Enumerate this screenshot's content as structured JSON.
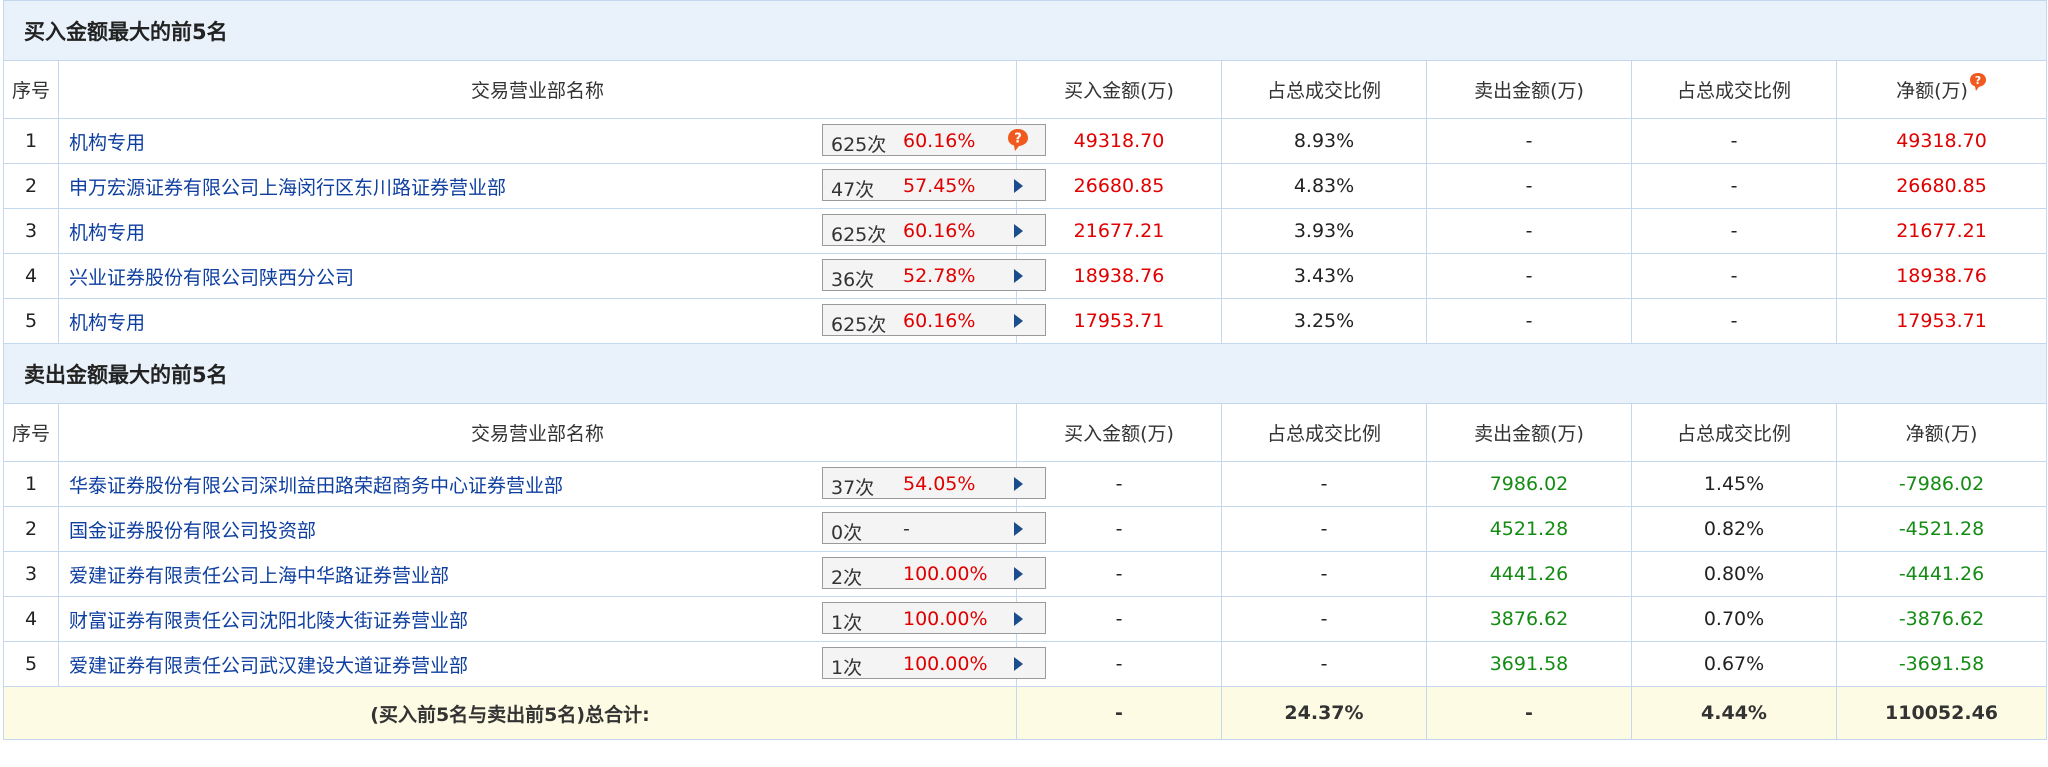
{
  "buy_section": {
    "title": "买入金额最大的前5名",
    "headers": [
      "序号",
      "交易营业部名称",
      "买入金额(万)",
      "占总成交比例",
      "卖出金额(万)",
      "占总成交比例",
      "净额(万)"
    ],
    "rows": [
      {
        "no": "1",
        "name": "机构专用",
        "count": "625次",
        "pct": "60.16%",
        "buy": "49318.70",
        "buy_ratio": "8.93%",
        "sell": "-",
        "sell_ratio": "-",
        "net": "49318.70"
      },
      {
        "no": "2",
        "name": "申万宏源证券有限公司上海闵行区东川路证券营业部",
        "count": "47次",
        "pct": "57.45%",
        "buy": "26680.85",
        "buy_ratio": "4.83%",
        "sell": "-",
        "sell_ratio": "-",
        "net": "26680.85"
      },
      {
        "no": "3",
        "name": "机构专用",
        "count": "625次",
        "pct": "60.16%",
        "buy": "21677.21",
        "buy_ratio": "3.93%",
        "sell": "-",
        "sell_ratio": "-",
        "net": "21677.21"
      },
      {
        "no": "4",
        "name": "兴业证券股份有限公司陕西分公司",
        "count": "36次",
        "pct": "52.78%",
        "buy": "18938.76",
        "buy_ratio": "3.43%",
        "sell": "-",
        "sell_ratio": "-",
        "net": "18938.76"
      },
      {
        "no": "5",
        "name": "机构专用",
        "count": "625次",
        "pct": "60.16%",
        "buy": "17953.71",
        "buy_ratio": "3.25%",
        "sell": "-",
        "sell_ratio": "-",
        "net": "17953.71"
      }
    ]
  },
  "sell_section": {
    "title": "卖出金额最大的前5名",
    "headers": [
      "序号",
      "交易营业部名称",
      "买入金额(万)",
      "占总成交比例",
      "卖出金额(万)",
      "占总成交比例",
      "净额(万)"
    ],
    "rows": [
      {
        "no": "1",
        "name": "华泰证券股份有限公司深圳益田路荣超商务中心证券营业部",
        "count": "37次",
        "pct": "54.05%",
        "buy": "-",
        "buy_ratio": "-",
        "sell": "7986.02",
        "sell_ratio": "1.45%",
        "net": "-7986.02"
      },
      {
        "no": "2",
        "name": "国金证券股份有限公司投资部",
        "count": "0次",
        "pct": "-",
        "buy": "-",
        "buy_ratio": "-",
        "sell": "4521.28",
        "sell_ratio": "0.82%",
        "net": "-4521.28"
      },
      {
        "no": "3",
        "name": "爱建证券有限责任公司上海中华路证券营业部",
        "count": "2次",
        "pct": "100.00%",
        "buy": "-",
        "buy_ratio": "-",
        "sell": "4441.26",
        "sell_ratio": "0.80%",
        "net": "-4441.26"
      },
      {
        "no": "4",
        "name": "财富证券有限责任公司沈阳北陵大街证券营业部",
        "count": "1次",
        "pct": "100.00%",
        "buy": "-",
        "buy_ratio": "-",
        "sell": "3876.62",
        "sell_ratio": "0.70%",
        "net": "-3876.62"
      },
      {
        "no": "5",
        "name": "爱建证券有限责任公司武汉建设大道证券营业部",
        "count": "1次",
        "pct": "100.00%",
        "buy": "-",
        "buy_ratio": "-",
        "sell": "3691.58",
        "sell_ratio": "0.67%",
        "net": "-3691.58"
      }
    ]
  },
  "total": {
    "label": "(买入前5名与卖出前5名)总合计:",
    "buy": "-",
    "buy_ratio": "24.37%",
    "sell": "-",
    "sell_ratio": "4.44%",
    "net": "110052.46"
  },
  "colors": {
    "header_bg": "#e9f2fb",
    "border": "#c3d8ee",
    "link": "#0e3fa0",
    "positive": "#e00000",
    "negative": "#148c14",
    "total_bg": "#fdfbe3"
  },
  "icons": [
    "question-badge-icon",
    "expand-arrow-icon"
  ]
}
